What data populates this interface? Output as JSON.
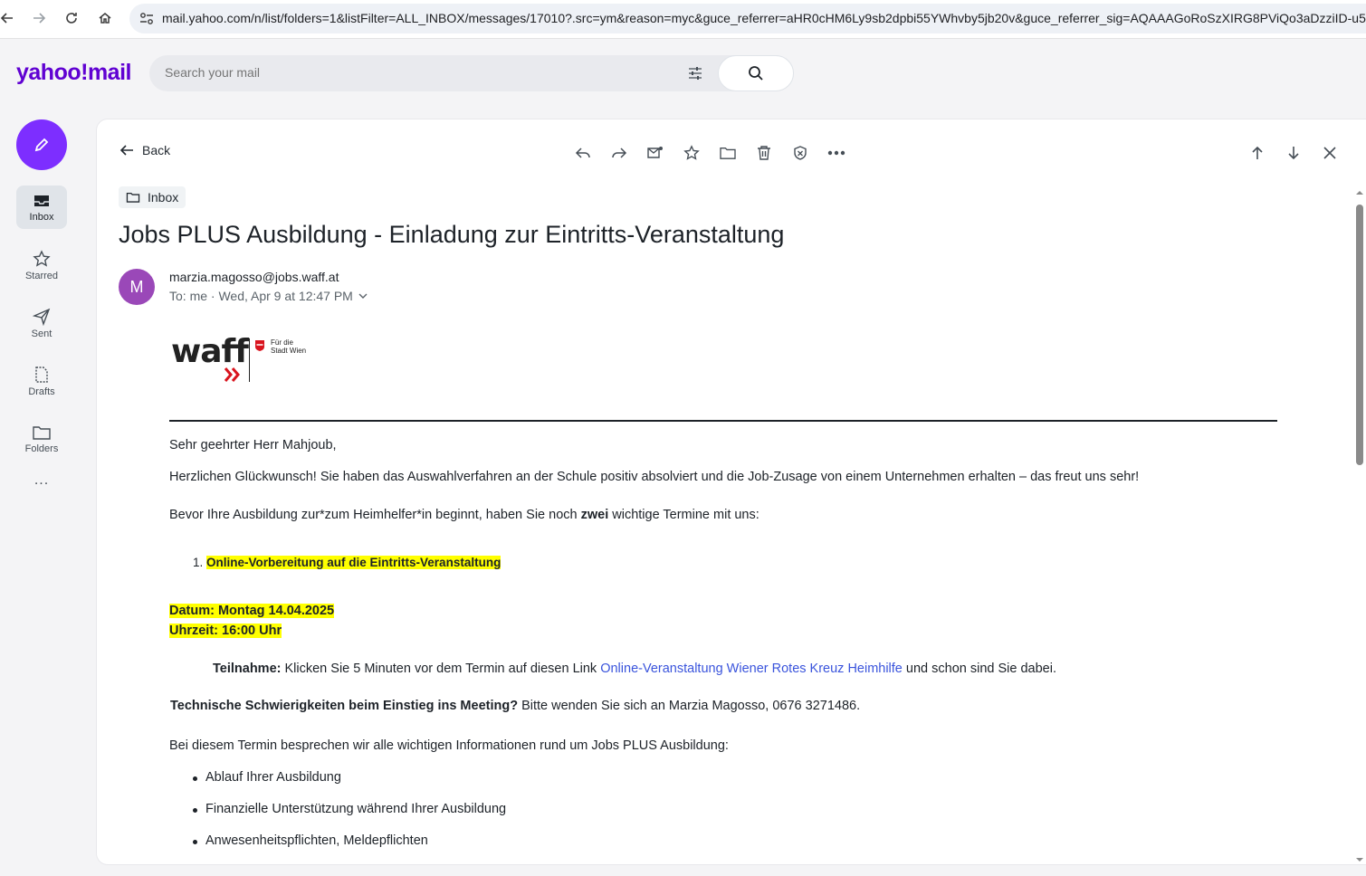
{
  "browser": {
    "url": "mail.yahoo.com/n/list/folders=1&listFilter=ALL_INBOX/messages/17010?.src=ym&reason=myc&guce_referrer=aHR0cHM6Ly9sb2dpbi55YWhvby5jb20v&guce_referrer_sig=AQAAAGoRoSzXIRG8PViQo3aDzziID-u555xr"
  },
  "header": {
    "logo": "yahoo!mail",
    "search_placeholder": "Search your mail"
  },
  "rail": {
    "items": [
      {
        "label": "Inbox",
        "icon": "inbox-icon"
      },
      {
        "label": "Starred",
        "icon": "star-icon"
      },
      {
        "label": "Sent",
        "icon": "send-icon"
      },
      {
        "label": "Drafts",
        "icon": "draft-icon"
      },
      {
        "label": "Folders",
        "icon": "folder-icon"
      }
    ],
    "more": "..."
  },
  "message": {
    "back_label": "Back",
    "folder": "Inbox",
    "subject": "Jobs PLUS Ausbildung - Einladung zur Eintritts-Veranstaltung",
    "avatar_letter": "M",
    "sender": "marzia.magosso@jobs.waff.at",
    "meta": "To:  me · Wed, Apr 9 at 12:47 PM",
    "logo_text": "waff",
    "logo_sub1": "Für die",
    "logo_sub2": "Stadt Wien"
  },
  "body": {
    "greeting": "Sehr geehrter Herr Mahjoub,",
    "p1": "Herzlichen Glückwunsch! Sie haben das Auswahlverfahren an der Schule positiv absolviert und die Job-Zusage von einem Unternehmen erhalten – das freut uns sehr!",
    "p2_a": "Bevor Ihre Ausbildung zur*zum Heimhelfer*in beginnt, haben Sie noch ",
    "p2_b": "zwei",
    "p2_c": " wichtige Termine mit uns:",
    "list_num": "1.",
    "list_item1": "Online-Vorbereitung auf die Eintritts-Veranstaltung",
    "datum_label": "Datum",
    "datum_value": ": Montag 14.04.2025",
    "uhrzeit": "Uhrzeit: 16:00 Uhr",
    "teilnahme_label": "Teilnahme:",
    "teilnahme_text": " Klicken Sie 5 Minuten vor dem Termin auf diesen Link ",
    "teilnahme_link": "Online-Veranstaltung Wiener Rotes Kreuz Heimhilfe",
    "teilnahme_end": " und schon sind Sie dabei.",
    "tech_label": "Technische Schwierigkeiten beim Einstieg ins Meeting?",
    "tech_text": " Bitte wenden Sie sich an Marzia Magosso, 0676 3271486.",
    "p3": "Bei diesem Termin besprechen wir alle wichtigen Informationen rund um Jobs PLUS Ausbildung:",
    "bullets": [
      "Ablauf Ihrer Ausbildung",
      "Finanzielle Unterstützung während Ihrer Ausbildung",
      "Anwesenheitspflichten, Meldepflichten"
    ]
  },
  "colors": {
    "accent": "#7d2eff",
    "logo": "#6001d2",
    "avatar": "#9a48b8",
    "highlight": "#ffff00",
    "link": "#3a54dc"
  }
}
